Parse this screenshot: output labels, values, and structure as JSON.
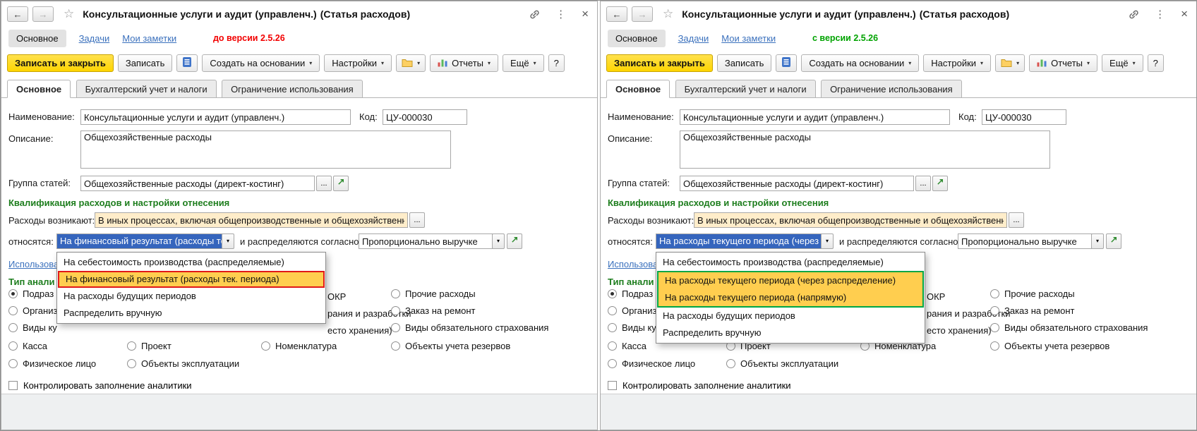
{
  "window": {
    "title": "Консультационные услуги и аудит (управленч.)",
    "title_suffix": "(Статья расходов)"
  },
  "icons": {
    "back": "←",
    "forward": "→",
    "star": "☆",
    "kebab": "⋮",
    "close": "×",
    "menu_arrow": "▾",
    "ellipsis": "...",
    "help": "?"
  },
  "nav": {
    "main": "Основное",
    "tasks": "Задачи",
    "notes": "Мои заметки"
  },
  "toolbar": {
    "save_close": "Записать и закрыть",
    "save": "Записать",
    "create_from": "Создать на основании",
    "settings": "Настройки",
    "reports": "Отчеты",
    "more": "Ещё",
    "help": "?"
  },
  "tabs": {
    "main": "Основное",
    "accounting": "Бухгалтерский учет и налоги",
    "restriction": "Ограничение использования"
  },
  "form": {
    "name_label": "Наименование:",
    "name_value": "Консультационные услуги и аудит (управленч.)",
    "code_label": "Код:",
    "code_value": "ЦУ-000030",
    "desc_label": "Описание:",
    "desc_value": "Общехозяйственные расходы",
    "group_label": "Группа статей:",
    "group_value": "Общехозяйственные расходы (директ-костинг)",
    "section_header": "Квалификация расходов и настройки отнесения",
    "occur_label": "Расходы возникают:",
    "occur_value": "В иных процессах, включая общепроизводственные и общехозяйственные",
    "relate_label": "относятся:",
    "distribute_label": "и распределяются согласно:",
    "distribute_value": "Пропорционально выручке",
    "usage_link_fragment": "Использова",
    "analytics_header_fragment": "Тип анали",
    "control_checkbox": "Контролировать заполнение аналитики"
  },
  "analytics": {
    "col1": [
      "Подраз",
      "Организ",
      "Виды ку",
      "Касса",
      "Физическое лицо"
    ],
    "col2": [
      "Проект",
      "Объекты эксплуатации"
    ],
    "col3_fragments": [
      "ОКР",
      "рания и разработки",
      "есто хранения)"
    ],
    "col3_item": "Номенклатура",
    "col4": [
      "Прочие расходы",
      "Заказ на ремонт",
      "Виды обязательного страхования",
      "Объекты учета резервов"
    ]
  },
  "panels": [
    {
      "version_note": "до версии 2.5.26",
      "relate_value": "На финансовый результат (расходы тек. пе",
      "dropdown_items": [
        "На себестоимость производства (распределяемые)",
        "На финансовый результат (расходы тек. периода)",
        "На расходы будущих периодов",
        "Распределить вручную"
      ]
    },
    {
      "version_note": "с версии 2.5.26",
      "relate_value": "На расходы текущего периода (через расп",
      "dropdown_items": [
        "На себестоимость производства (распределяемые)",
        "На расходы текущего периода (через распределение)",
        "На расходы текущего периода (напрямую)",
        "На расходы будущих периодов",
        "Распределить вручную"
      ]
    }
  ],
  "colors": {
    "primary_button_yellow": "#ffd814",
    "highlight_orange": "#ffce4f",
    "old_version_red": "#f20000",
    "new_version_green": "#00a300",
    "frame_red": "#e01919",
    "frame_green": "#00a646",
    "section_header_green": "#1e7e1e",
    "link_blue": "#3b71bd",
    "selection_blue": "#3565bd",
    "required_field_cream": "#ffedca",
    "title_underline_green": "#00b41e"
  }
}
